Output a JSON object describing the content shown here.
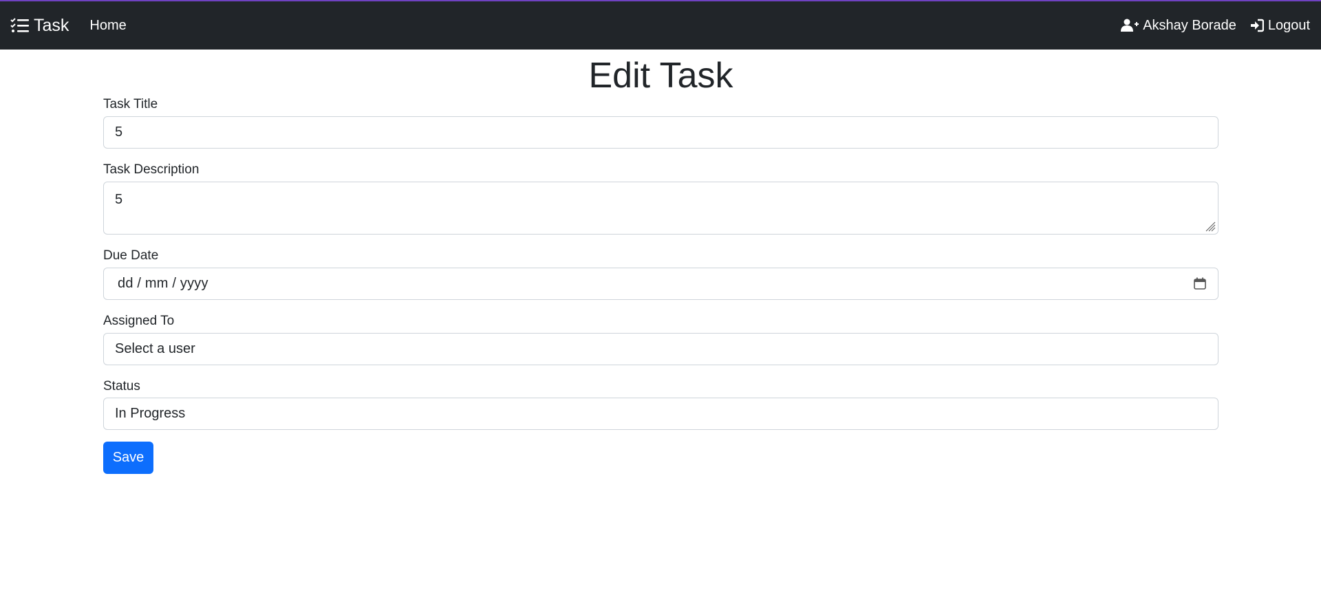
{
  "navbar": {
    "brand_label": "Task",
    "brand_icon": "list-check-icon",
    "home_label": "Home",
    "user_name": "Akshay Borade",
    "user_icon": "user-plus-icon",
    "logout_label": "Logout",
    "logout_icon": "sign-in-icon"
  },
  "page": {
    "title": "Edit Task"
  },
  "form": {
    "title_label": "Task Title",
    "title_value": "5",
    "description_label": "Task Description",
    "description_value": "5",
    "due_date_label": "Due Date",
    "due_date_placeholder": "dd / mm / yyyy",
    "assigned_label": "Assigned To",
    "assigned_value": "Select a user",
    "status_label": "Status",
    "status_value": "In Progress",
    "save_label": "Save"
  },
  "colors": {
    "navbar_bg": "#212529",
    "accent_line": "#6f42c1",
    "primary_button": "#0d6efd"
  }
}
